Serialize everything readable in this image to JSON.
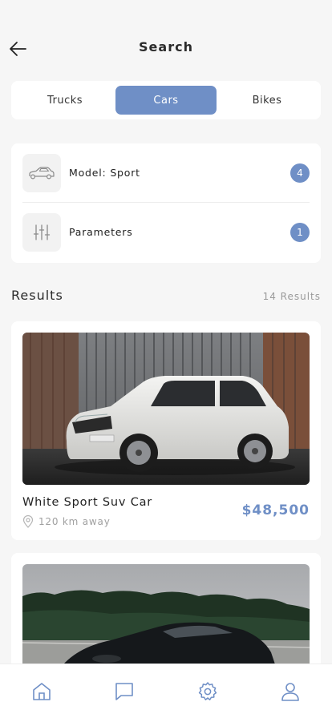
{
  "header": {
    "title": "Search",
    "back_icon": "arrow-left-icon"
  },
  "segments": [
    {
      "label": "Trucks",
      "active": false
    },
    {
      "label": "Cars",
      "active": true
    },
    {
      "label": "Bikes",
      "active": false
    }
  ],
  "filters": [
    {
      "icon": "car-icon",
      "label": "Model: Sport",
      "count": "4"
    },
    {
      "icon": "sliders-icon",
      "label": "Parameters",
      "count": "1"
    }
  ],
  "results": {
    "title": "Results",
    "count_text": "14 Results"
  },
  "listings": [
    {
      "name": "White Sport Suv Car",
      "distance": "120 km away",
      "price": "$48,500",
      "image": "white-suv-photo"
    },
    {
      "name": "",
      "distance": "",
      "price": "",
      "image": "black-coupe-photo"
    }
  ],
  "tabbar": [
    {
      "icon": "home-icon",
      "active": true
    },
    {
      "icon": "chat-icon",
      "active": false
    },
    {
      "icon": "settings-icon",
      "active": false
    },
    {
      "icon": "profile-icon",
      "active": false
    }
  ],
  "colors": {
    "accent": "#6f8fc6",
    "background": "#f6f6f6",
    "card": "#ffffff"
  }
}
